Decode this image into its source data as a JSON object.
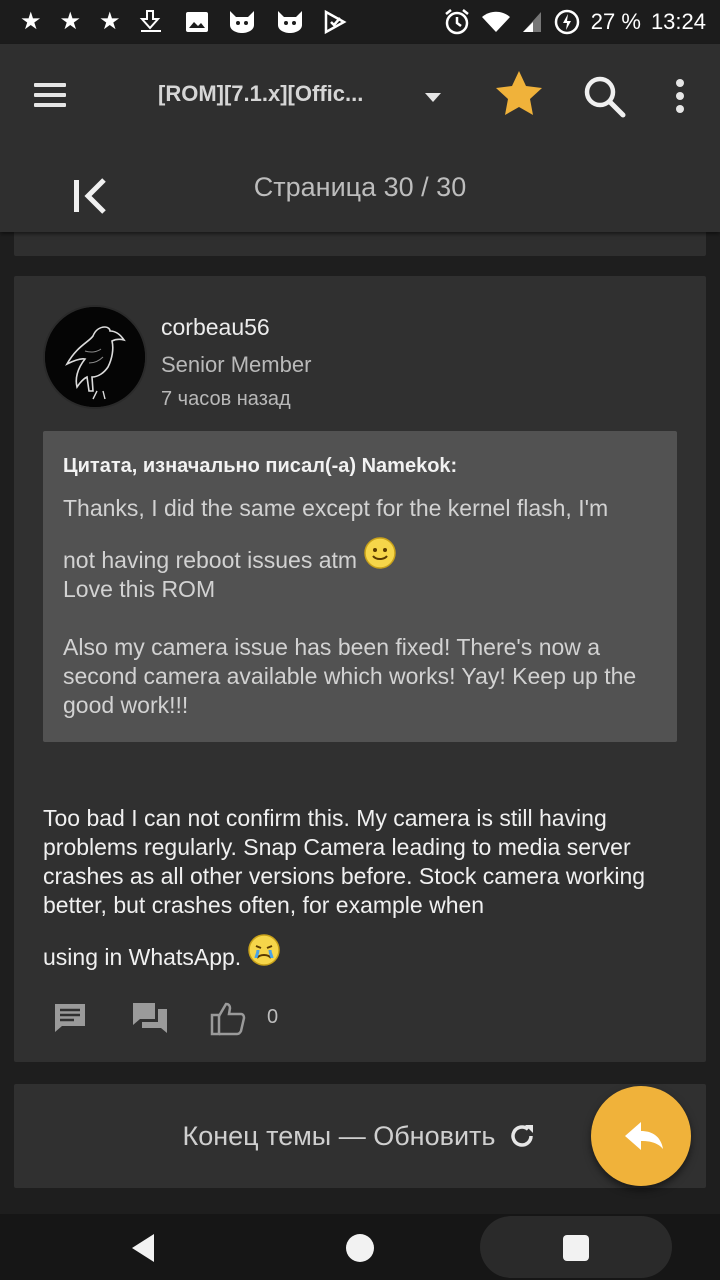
{
  "status_bar": {
    "battery": "27 %",
    "time": "13:24"
  },
  "app_bar": {
    "title": "[ROM][7.1.x][Offic...",
    "page_label": "Страница 30 / 30"
  },
  "post": {
    "username": "corbeau56",
    "role": "Senior Member",
    "time": "7 часов назад",
    "quote": {
      "author": "Цитата, изначально писал(-а) Namekok:",
      "line1": "Thanks, I did the same except for the kernel flash, I'm",
      "line2": "not having reboot issues atm",
      "line3": "Love this ROM",
      "line4": "Also my camera issue has been fixed! There's now a second camera available which works! Yay! Keep up the good work!!!"
    },
    "body_main": "Too bad I can not confirm this. My camera is still having problems regularly. Snap Camera leading to media server crashes as all other versions before. Stock camera working better, but crashes often, for example when",
    "body_end": "using in WhatsApp.",
    "like_count": "0"
  },
  "footer": {
    "end_label": "Конец темы — Обновить"
  },
  "colors": {
    "accent": "#f0b23a",
    "card": "#303030",
    "quote_bg": "#525252"
  }
}
